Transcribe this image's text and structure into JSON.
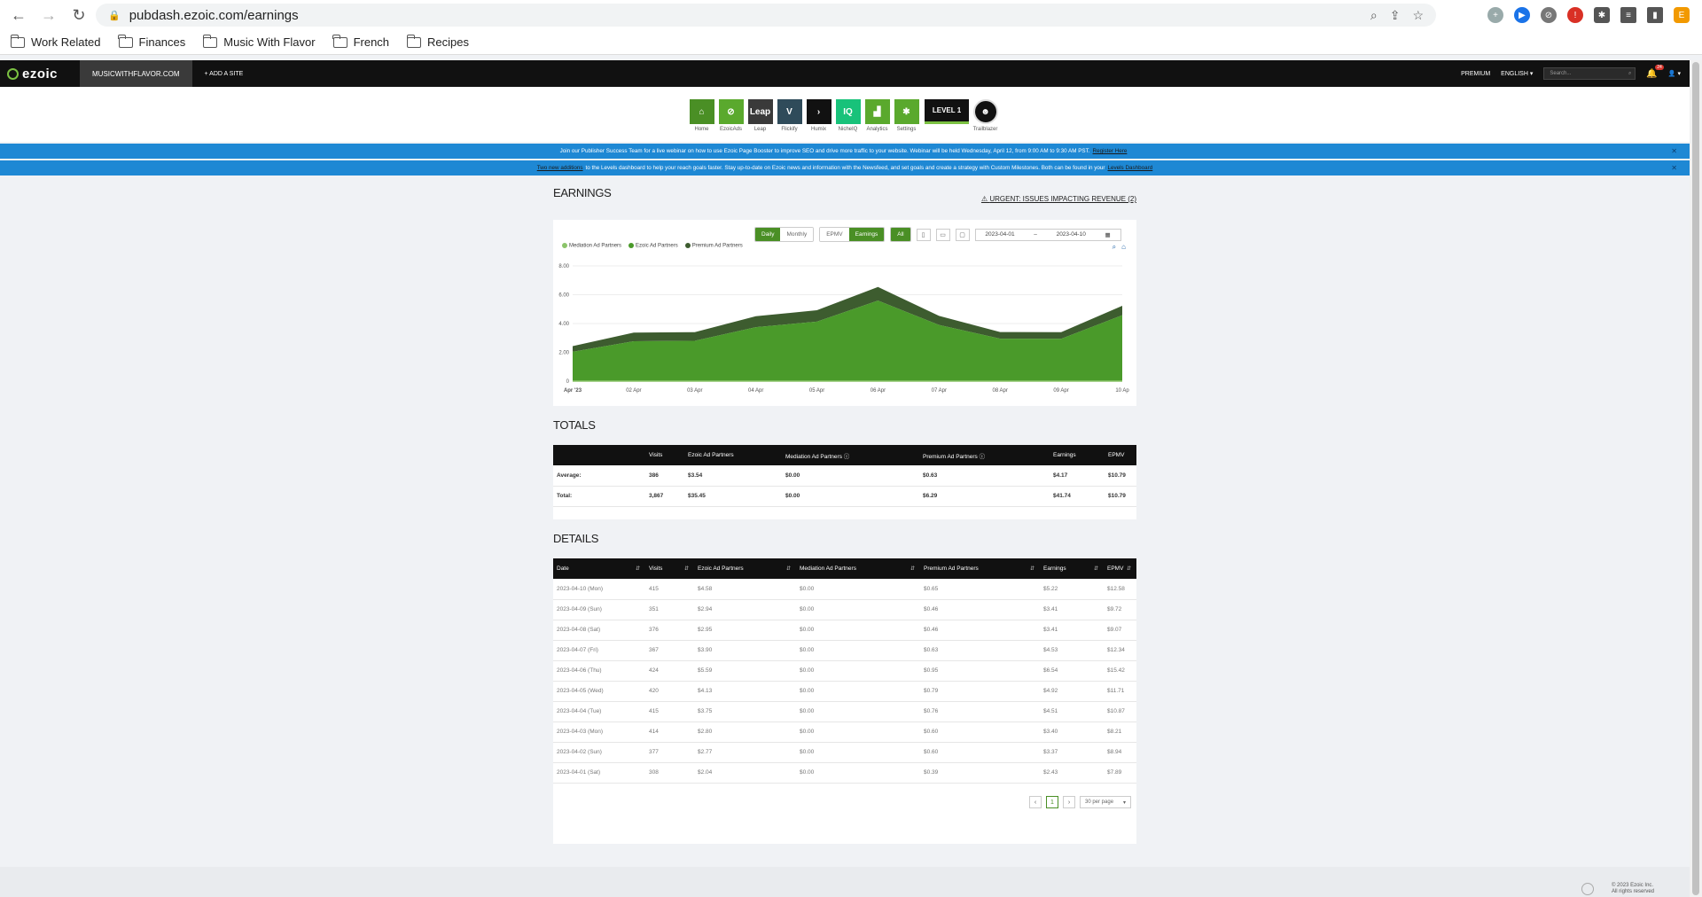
{
  "browser": {
    "url": "pubdash.ezoic.com/earnings",
    "bookmarks": [
      "Work Related",
      "Finances",
      "Music With Flavor",
      "French",
      "Recipes"
    ]
  },
  "topbar": {
    "logo": "ezoic",
    "site": "MUSICWITHFLAVOR.COM",
    "add_site": "+ ADD A SITE",
    "premium": "PREMIUM",
    "language": "ENGLISH",
    "search_placeholder": "Search...",
    "notif_count": "24"
  },
  "apps": [
    {
      "label": "Home",
      "color": "#4a8f25",
      "glyph": "⌂",
      "icon": "home-icon"
    },
    {
      "label": "EzoicAds",
      "color": "#5aa92d",
      "glyph": "⊘",
      "icon": "ezoicads-icon"
    },
    {
      "label": "Leap",
      "color": "#3a3a3a",
      "glyph": "Leap",
      "icon": "leap-icon"
    },
    {
      "label": "Flickify",
      "color": "#2f4b5a",
      "glyph": "V",
      "icon": "flickify-icon"
    },
    {
      "label": "Humix",
      "color": "#111111",
      "glyph": "›",
      "icon": "humix-icon"
    },
    {
      "label": "NicheIQ",
      "color": "#18c27a",
      "glyph": "IQ",
      "icon": "nicheiq-icon"
    },
    {
      "label": "Analytics",
      "color": "#5aa92d",
      "glyph": "▟",
      "icon": "analytics-icon"
    },
    {
      "label": "Settings",
      "color": "#5aa92d",
      "glyph": "✱",
      "icon": "settings-icon"
    }
  ],
  "level_badge": "LEVEL 1",
  "trailblazer_label": "Trailblazer",
  "banners": {
    "webinar_text": "Join our Publisher Success Team for a live webinar on how to use Ezoic Page Booster to improve SEO and drive more traffic to your website. Webinar will be held Wednesday, April 12, from 9:00 AM to 9:30 AM PST.",
    "webinar_link": "Register Here",
    "levels_lead": "Two new additions",
    "levels_text": "to the Levels dashboard to help your reach goals faster. Stay up-to-date on Ezoic news and information with the Newsfeed, and set goals and create a strategy with Custom Milestones. Both can be found in your",
    "levels_link": "Levels Dashboard"
  },
  "earnings": {
    "title": "EARNINGS",
    "urgent": "URGENT: ISSUES IMPACTING REVENUE (2)",
    "toggle_daily": "Daily",
    "toggle_monthly": "Monthly",
    "toggle_epmv": "EPMV",
    "toggle_earnings": "Earnings",
    "toggle_all": "All",
    "date_from": "2023-04-01",
    "date_to": "2023-04-10",
    "colors": {
      "mediation": "#8bc46a",
      "ezoic": "#4a9a2a",
      "premium": "#3d5c2f"
    }
  },
  "chart_data": {
    "type": "area",
    "title": "",
    "x": [
      "Apr '23",
      "02 Apr",
      "03 Apr",
      "04 Apr",
      "05 Apr",
      "06 Apr",
      "07 Apr",
      "08 Apr",
      "09 Apr",
      "10 Ap"
    ],
    "y_ticks": [
      "8.00",
      "6.00",
      "4.00",
      "2.00",
      "0"
    ],
    "ylim": [
      0,
      8
    ],
    "stacked": true,
    "series": [
      {
        "name": "Mediation Ad Partners",
        "values": [
          0,
          0,
          0,
          0,
          0,
          0,
          0,
          0,
          0,
          0
        ]
      },
      {
        "name": "Ezoic Ad Partners",
        "values": [
          2.04,
          2.77,
          2.8,
          3.75,
          4.13,
          5.59,
          3.9,
          2.95,
          2.94,
          4.58
        ]
      },
      {
        "name": "Premium Ad Partners",
        "values": [
          0.39,
          0.6,
          0.6,
          0.76,
          0.79,
          0.95,
          0.63,
          0.46,
          0.46,
          0.65
        ]
      }
    ],
    "legend": "top-left"
  },
  "totals": {
    "title": "TOTALS",
    "headers": [
      "",
      "Visits",
      "Ezoic Ad Partners",
      "Mediation Ad Partners",
      "Premium Ad Partners",
      "Earnings",
      "EPMV"
    ],
    "rows": [
      [
        "Average:",
        "386",
        "$3.54",
        "$0.00",
        "$0.63",
        "$4.17",
        "$10.79"
      ],
      [
        "Total:",
        "3,867",
        "$35.45",
        "$0.00",
        "$6.29",
        "$41.74",
        "$10.79"
      ]
    ]
  },
  "details": {
    "title": "DETAILS",
    "headers": [
      "Date",
      "Visits",
      "Ezoic Ad Partners",
      "Mediation Ad Partners",
      "Premium Ad Partners",
      "Earnings",
      "EPMV"
    ],
    "rows": [
      [
        "2023-04-10 (Mon)",
        "415",
        "$4.58",
        "$0.00",
        "$0.65",
        "$5.22",
        "$12.58"
      ],
      [
        "2023-04-09 (Sun)",
        "351",
        "$2.94",
        "$0.00",
        "$0.46",
        "$3.41",
        "$9.72"
      ],
      [
        "2023-04-08 (Sat)",
        "376",
        "$2.95",
        "$0.00",
        "$0.46",
        "$3.41",
        "$9.07"
      ],
      [
        "2023-04-07 (Fri)",
        "367",
        "$3.90",
        "$0.00",
        "$0.63",
        "$4.53",
        "$12.34"
      ],
      [
        "2023-04-06 (Thu)",
        "424",
        "$5.59",
        "$0.00",
        "$0.95",
        "$6.54",
        "$15.42"
      ],
      [
        "2023-04-05 (Wed)",
        "420",
        "$4.13",
        "$0.00",
        "$0.79",
        "$4.92",
        "$11.71"
      ],
      [
        "2023-04-04 (Tue)",
        "415",
        "$3.75",
        "$0.00",
        "$0.76",
        "$4.51",
        "$10.87"
      ],
      [
        "2023-04-03 (Mon)",
        "414",
        "$2.80",
        "$0.00",
        "$0.60",
        "$3.40",
        "$8.21"
      ],
      [
        "2023-04-02 (Sun)",
        "377",
        "$2.77",
        "$0.00",
        "$0.60",
        "$3.37",
        "$8.94"
      ],
      [
        "2023-04-01 (Sat)",
        "308",
        "$2.04",
        "$0.00",
        "$0.39",
        "$2.43",
        "$7.89"
      ]
    ],
    "page": "1",
    "per_page": "30 per page"
  },
  "footer": {
    "copyright": "© 2023 Ezoic Inc.",
    "rights": "All rights reserved"
  }
}
